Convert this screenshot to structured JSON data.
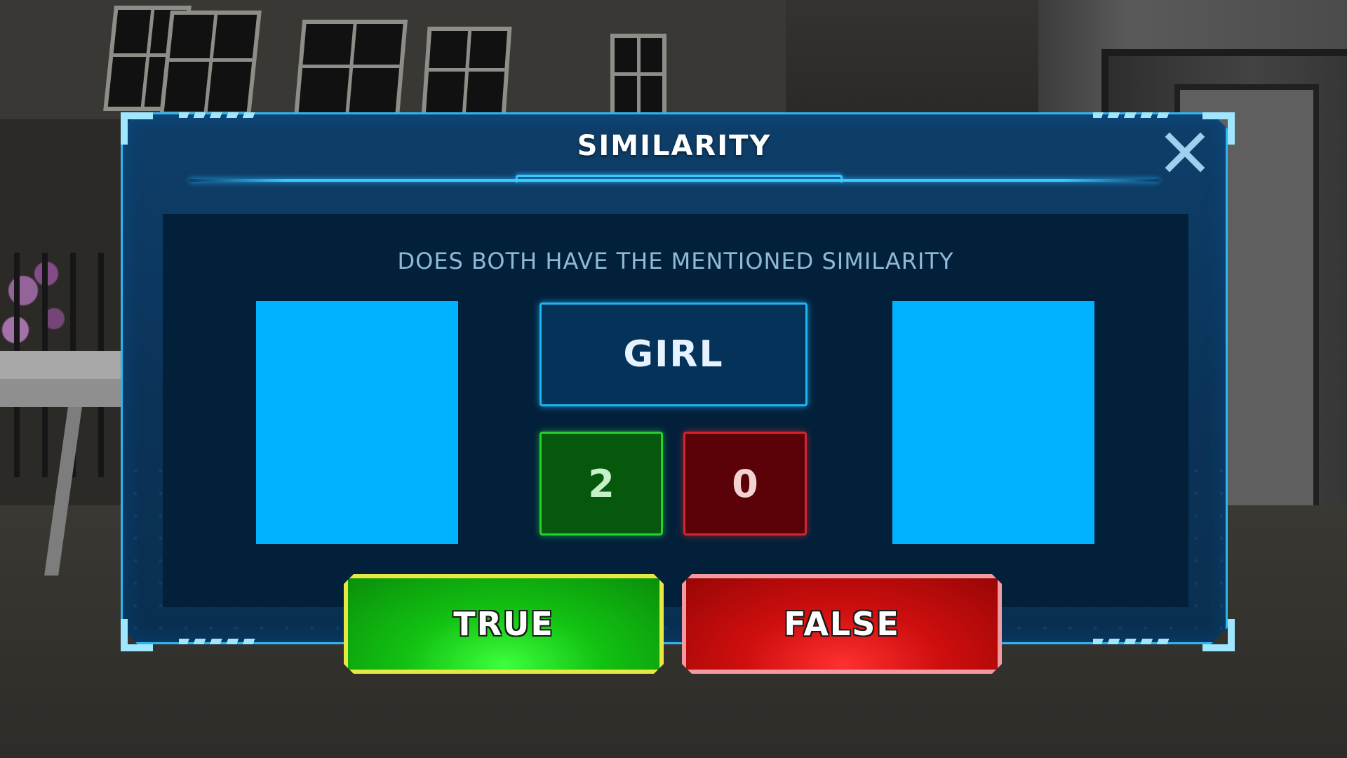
{
  "dialog": {
    "title": "SIMILARITY",
    "close_icon": "close-icon",
    "question": "DOES BOTH HAVE THE MENTIONED SIMILARITY",
    "word": "GIRL",
    "score_correct": "2",
    "score_wrong": "0",
    "true_label": "TRUE",
    "false_label": "FALSE"
  },
  "colors": {
    "panel": "#0b3358",
    "accent": "#2fb6f0",
    "card": "#00b2ff",
    "correct": "#06580c",
    "wrong": "#5a0208",
    "true_button": "#12c112",
    "false_button": "#cf0e0e"
  }
}
